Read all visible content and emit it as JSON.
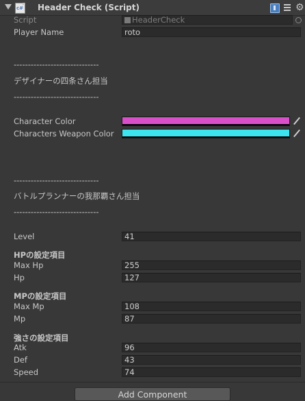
{
  "component": {
    "title": "Header Check (Script)",
    "enabled": true
  },
  "fields": {
    "script": {
      "label": "Script",
      "value": "HeaderCheck"
    },
    "player_name": {
      "label": "Player Name",
      "value": "roto"
    },
    "separator_1": "------------------------------",
    "designer_header": "デザイナーの四条さん担当",
    "separator_2": "------------------------------",
    "character_color": {
      "label": "Character Color",
      "color": "#d94ec9"
    },
    "weapon_color": {
      "label": "Characters Weapon Color",
      "color": "#3de3ef"
    },
    "separator_3": "------------------------------",
    "battle_header": "バトルプランナーの我那覇さん担当",
    "separator_4": "------------------------------",
    "level": {
      "label": "Level",
      "value": "41"
    },
    "hp_group": "HPの設定項目",
    "max_hp": {
      "label": "Max Hp",
      "value": "255"
    },
    "hp": {
      "label": "Hp",
      "value": "127"
    },
    "mp_group": "MPの設定項目",
    "max_mp": {
      "label": "Max Mp",
      "value": "108"
    },
    "mp": {
      "label": "Mp",
      "value": "87"
    },
    "strength_group": "強さの設定項目",
    "atk": {
      "label": "Atk",
      "value": "96"
    },
    "def": {
      "label": "Def",
      "value": "43"
    },
    "speed": {
      "label": "Speed",
      "value": "74"
    }
  },
  "add_component_label": "Add Component",
  "icons": {
    "foldout": "foldout-arrow-icon",
    "script": "cs-script-icon",
    "help": "help-book-icon",
    "presets": "presets-icon",
    "settings": "gear-icon",
    "object_picker": "object-picker-icon",
    "eyedropper": "eyedropper-icon"
  }
}
